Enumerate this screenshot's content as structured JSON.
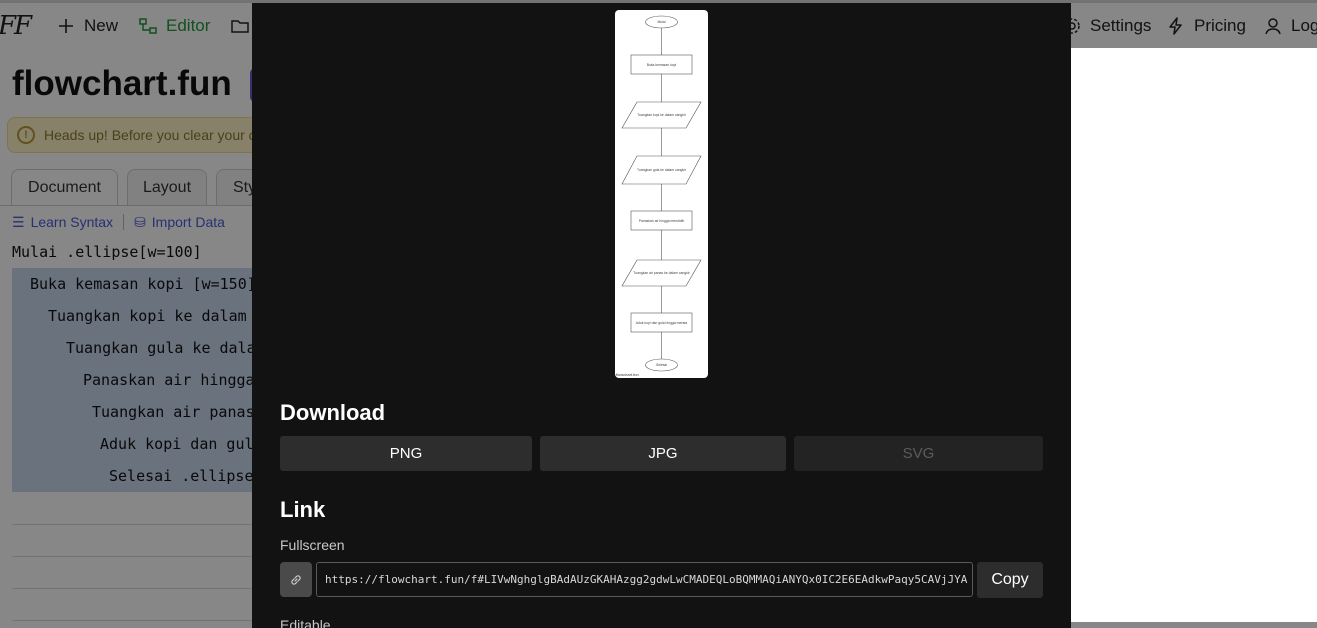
{
  "app": {
    "logo": "FF",
    "nav": {
      "new_label": "New",
      "editor_label": "Editor",
      "settings_label": "Settings",
      "pricing_label": "Pricing",
      "login_label": "Log"
    },
    "title": "flowchart.fun",
    "notice": "Heads up! Before you clear your c",
    "tabs": [
      "Document",
      "Layout",
      "Sty"
    ],
    "subtools": {
      "learn_syntax": "Learn Syntax",
      "import_data": "Import Data"
    },
    "code_lines": [
      "Mulai .ellipse[w=100]",
      "Buka kemasan kopi [w=150]",
      "Tuangkan kopi ke dalam",
      "Tuangkan gula ke dalam",
      "Panaskan air hingga",
      "Tuangkan air panas",
      "Aduk kopi dan gula",
      "Selesai .ellipse"
    ]
  },
  "modal": {
    "preview": {
      "nodes": [
        "Mulai",
        "Buka kemasan kopi",
        "Tuangkan kopi ke dalam cangkir",
        "Tuangkan gula ke dalam cangkir",
        "Panaskan air hingga mendidih",
        "Tuangkan air panas ke dalam cangkir",
        "Aduk kopi dan gula hingga merata",
        "Selesai"
      ],
      "watermark": "flowchart.fun"
    },
    "download": {
      "heading": "Download",
      "png": "PNG",
      "jpg": "JPG",
      "svg": "SVG"
    },
    "link": {
      "heading": "Link",
      "fullscreen_label": "Fullscreen",
      "fullscreen_url": "https://flowchart.fun/f#LIVwNghglgBAdAUzGKAHAzgg2gdwLwCMADEQLoBQMMAQiANYQx0IC2E6EAdkwPaqy5CAVjJYA",
      "copy_label": "Copy",
      "editable_label": "Editable"
    }
  },
  "colors": {
    "modal_bg": "#121212",
    "button_bg": "#2d2d2d",
    "editor_green": "#1f9a3a",
    "accent_blue": "#4a5bd6",
    "notice_bg": "#fdf3c4"
  }
}
